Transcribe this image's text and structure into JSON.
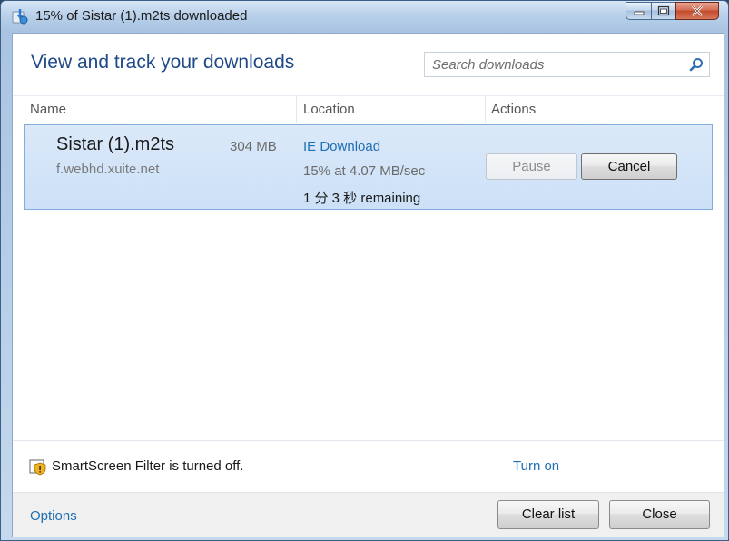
{
  "window": {
    "title": "15% of Sistar (1).m2ts downloaded"
  },
  "header": {
    "heading": "View and track your downloads",
    "search_placeholder": "Search downloads"
  },
  "columns": {
    "name": "Name",
    "location": "Location",
    "actions": "Actions"
  },
  "download": {
    "file_name": "Sistar (1).m2ts",
    "size": "304 MB",
    "host": "f.webhd.xuite.net",
    "location": "IE Download",
    "progress_text": "15% at 4.07 MB/sec",
    "progress_percent": 15,
    "remaining": "1 分 3 秒 remaining",
    "pause_label": "Pause",
    "cancel_label": "Cancel"
  },
  "smartscreen": {
    "status": "SmartScreen Filter is turned off.",
    "turn_on_label": "Turn on"
  },
  "footer": {
    "options_label": "Options",
    "clear_label": "Clear list",
    "close_label": "Close"
  },
  "colors": {
    "heading": "#1f4a87",
    "link": "#1f6fb3",
    "row_selected": "#cce0f7",
    "row_border": "#84acdd"
  },
  "icons": {
    "app": "ie-download-icon",
    "search": "search-icon",
    "shield": "shield-warning-icon",
    "minimize": "minimize-icon",
    "maximize": "maximize-icon",
    "close": "close-icon"
  }
}
